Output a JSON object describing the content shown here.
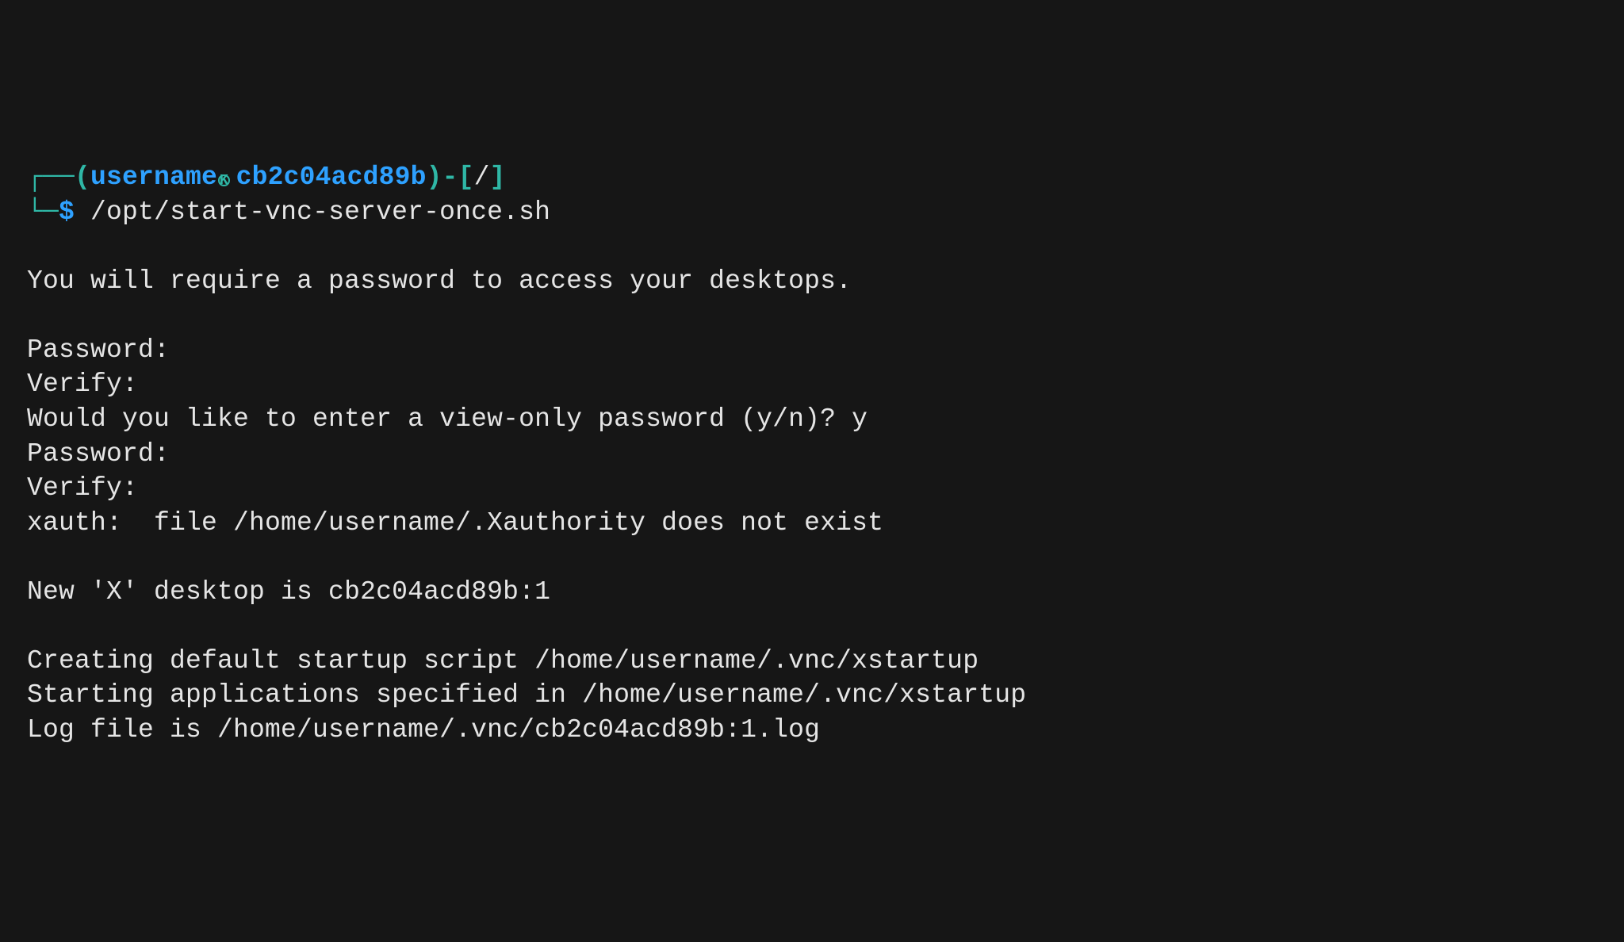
{
  "prompt": {
    "box_tl": "┌──",
    "paren_open": "(",
    "user": "username",
    "at_glyph": "K",
    "host": "cb2c04acd89b",
    "paren_close": ")",
    "dash": "-",
    "bracket_open": "[",
    "cwd": "/",
    "bracket_close": "]",
    "box_bl": "└─",
    "dollar": "$",
    "command": "/opt/start-vnc-server-once.sh"
  },
  "output": {
    "lines": [
      "",
      "You will require a password to access your desktops.",
      "",
      "Password:",
      "Verify:",
      "Would you like to enter a view-only password (y/n)? y",
      "Password:",
      "Verify:",
      "xauth:  file /home/username/.Xauthority does not exist",
      "",
      "New 'X' desktop is cb2c04acd89b:1",
      "",
      "Creating default startup script /home/username/.vnc/xstartup",
      "Starting applications specified in /home/username/.vnc/xstartup",
      "Log file is /home/username/.vnc/cb2c04acd89b:1.log"
    ]
  }
}
